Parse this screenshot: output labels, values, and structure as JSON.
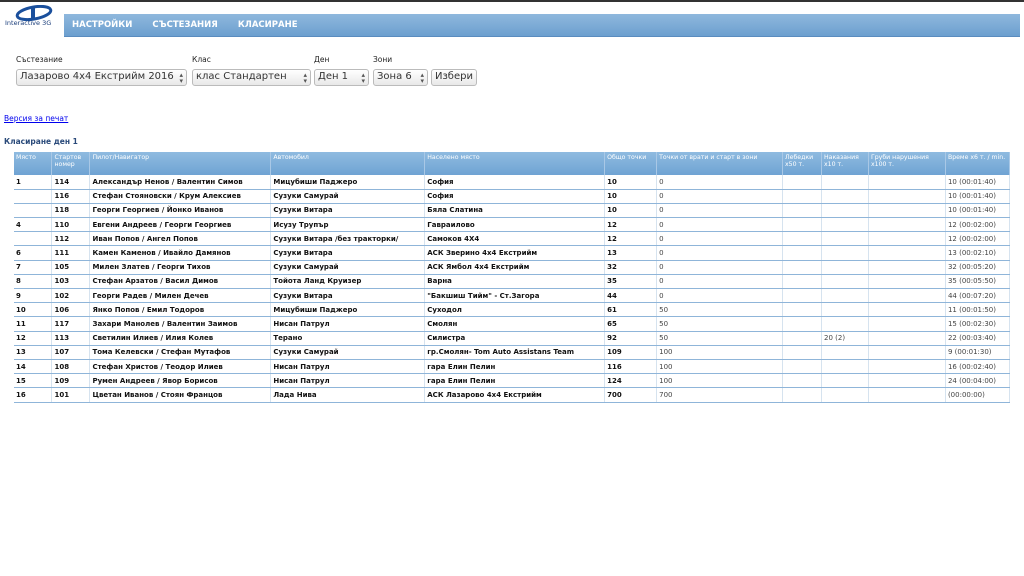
{
  "logo": {
    "text": "Interactive 3G"
  },
  "nav": [
    "НАСТРОЙКИ",
    "СЪСТЕЗАНИЯ",
    "КЛАСИРАНЕ"
  ],
  "filters": {
    "competition": {
      "label": "Състезание",
      "value": "Лазарово 4x4 Екстрийм 2016"
    },
    "class": {
      "label": "Клас",
      "value": "клас Стандартен"
    },
    "day": {
      "label": "Ден",
      "value": "Ден 1"
    },
    "zones": {
      "label": "Зони",
      "value": "Зона 6"
    },
    "submit": "Избери"
  },
  "print_link": "Версия за печат",
  "heading": "Класиране ден 1",
  "table": {
    "headers": [
      "Място",
      "Стартов номер",
      "Пилот/Навигатор",
      "Автомобил",
      "Населено място",
      "Общо точки",
      "Точки от врати и старт в зони",
      "Лебедки x50 т.",
      "Наказания x10 т.",
      "Груби нарушения x100 т.",
      "Време x6 т. / min."
    ],
    "rows": [
      [
        "1",
        "114",
        "Александър Ненов / Валентин Симов",
        "Мицубиши Паджеро",
        "София",
        "10",
        "0",
        "",
        "",
        "",
        "10 (00:01:40)"
      ],
      [
        "",
        "116",
        "Стефан Стояновски / Крум Алексиев",
        "Сузуки Самурай",
        "София",
        "10",
        "0",
        "",
        "",
        "",
        "10 (00:01:40)"
      ],
      [
        "",
        "118",
        "Георги Георгиев / Йонко Иванов",
        "Сузуки Витара",
        "Бяла Слатина",
        "10",
        "0",
        "",
        "",
        "",
        "10 (00:01:40)"
      ],
      [
        "4",
        "110",
        "Евгени Андреев / Георги Георгиев",
        "Исузу Трупър",
        "Гавраилово",
        "12",
        "0",
        "",
        "",
        "",
        "12 (00:02:00)"
      ],
      [
        "",
        "112",
        "Иван Попов / Ангел Попов",
        "Сузуки Витара /без тракторки/",
        "Самоков 4X4",
        "12",
        "0",
        "",
        "",
        "",
        "12 (00:02:00)"
      ],
      [
        "6",
        "111",
        "Камен Каменов / Ивайло Дамянов",
        "Сузуки Витара",
        "АСК Зверино 4x4 Екстрийм",
        "13",
        "0",
        "",
        "",
        "",
        "13 (00:02:10)"
      ],
      [
        "7",
        "105",
        "Милен Златев / Георги Тихов",
        "Сузуки Самурай",
        "АСК Ямбол 4x4 Екстрийм",
        "32",
        "0",
        "",
        "",
        "",
        "32 (00:05:20)"
      ],
      [
        "8",
        "103",
        "Стефан Арзатов / Васил Димов",
        "Тойота Ланд Круизер",
        "Варна",
        "35",
        "0",
        "",
        "",
        "",
        "35 (00:05:50)"
      ],
      [
        "9",
        "102",
        "Георги Радев / Милен Дечев",
        "Сузуки Витара",
        "\"Бакшиш Тийм\" - Ст.Загора",
        "44",
        "0",
        "",
        "",
        "",
        "44 (00:07:20)"
      ],
      [
        "10",
        "106",
        "Янко Попов / Емил Тодоров",
        "Мицубиши Паджеро",
        "Суходол",
        "61",
        "50",
        "",
        "",
        "",
        "11 (00:01:50)"
      ],
      [
        "11",
        "117",
        "Захари Манолев / Валентин Заимов",
        "Нисан Патрул",
        "Смолян",
        "65",
        "50",
        "",
        "",
        "",
        "15 (00:02:30)"
      ],
      [
        "12",
        "113",
        "Светилин Илиев / Илия Колев",
        "Терано",
        "Силистра",
        "92",
        "50",
        "",
        "20 (2)",
        "",
        "22 (00:03:40)"
      ],
      [
        "13",
        "107",
        "Тома Келевски / Стефан Мутафов",
        "Сузуки Самурай",
        "гр.Смолян- Tom Auto Assistans Team",
        "109",
        "100",
        "",
        "",
        "",
        "9 (00:01:30)"
      ],
      [
        "14",
        "108",
        "Стефан Христов / Теодор Илиев",
        "Нисан Патрул",
        "гара Елин Пелин",
        "116",
        "100",
        "",
        "",
        "",
        "16 (00:02:40)"
      ],
      [
        "15",
        "109",
        "Румен Андреев / Явор Борисов",
        "Нисан Патрул",
        "гара Елин Пелин",
        "124",
        "100",
        "",
        "",
        "",
        "24 (00:04:00)"
      ],
      [
        "16",
        "101",
        "Цветан Иванов / Стоян Францов",
        "Лада Нива",
        "АСК Лазарово 4x4 Екстрийм",
        "700",
        "700",
        "",
        "",
        "",
        "(00:00:00)"
      ]
    ]
  }
}
